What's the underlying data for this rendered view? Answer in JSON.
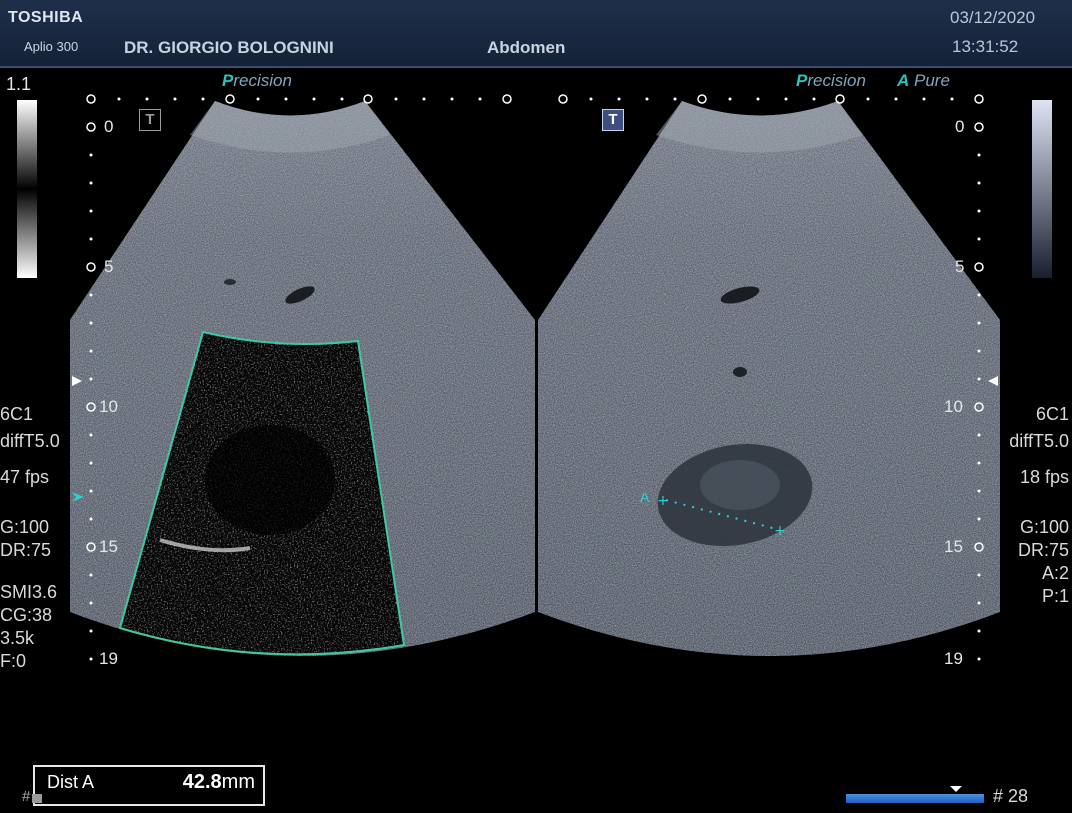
{
  "header": {
    "brand": "TOSHIBA",
    "model": "Aplio 300",
    "doctor": "DR. GIORGIO BOLOGNINI",
    "exam": "Abdomen",
    "date": "03/12/2020",
    "time": "13:31:52"
  },
  "gray_scale_value": "1.1",
  "left_image": {
    "precision_prefix": "P",
    "precision_rest": "recision",
    "depth_marks": [
      "0",
      "5",
      "10",
      "15",
      "19"
    ],
    "params": [
      "6C1",
      "diffT5.0",
      "47 fps",
      "G:100",
      "DR:75",
      "SMI3.6",
      "CG:38",
      "3.5k",
      "F:0"
    ]
  },
  "right_image": {
    "precision_prefix": "P",
    "precision_rest": "recision",
    "pure_prefix": "A",
    "pure_rest": "Pure",
    "depth_marks": [
      "0",
      "5",
      "10",
      "15",
      "19"
    ],
    "params": [
      "6C1",
      "diffT5.0",
      "18 fps",
      "G:100",
      "DR:75",
      "A:2",
      "P:1"
    ],
    "caliper_label": "A"
  },
  "measurement": {
    "label": "Dist A",
    "value": "42.8",
    "unit": "mm"
  },
  "frame": {
    "number": "# 28"
  },
  "colors": {
    "header_bg": "#1f2f4a",
    "caliper": "#2fd0d0",
    "roi_border": "#3fc9a0",
    "accent_text": "#29c3c0"
  }
}
